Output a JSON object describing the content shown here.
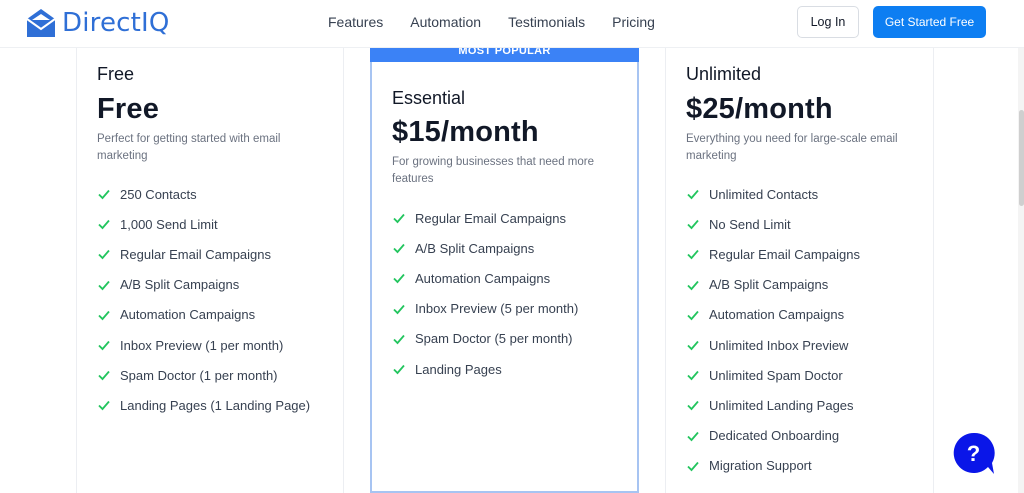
{
  "brand": {
    "name": "DirectIQ",
    "color": "#2f6fd6"
  },
  "nav": {
    "items": [
      "Features",
      "Automation",
      "Testimonials",
      "Pricing"
    ]
  },
  "header": {
    "login_label": "Log In",
    "cta_label": "Get Started Free"
  },
  "plans": [
    {
      "name": "Free",
      "price": "Free",
      "description": "Perfect for getting started with email marketing",
      "features": [
        "250 Contacts",
        "1,000 Send Limit",
        "Regular Email Campaigns",
        "A/B Split Campaigns",
        "Automation Campaigns",
        "Inbox Preview (1 per month)",
        "Spam Doctor (1 per month)",
        "Landing Pages (1 Landing Page)"
      ]
    },
    {
      "badge": "MOST POPULAR",
      "name": "Essential",
      "price": "$15/month",
      "description": "For growing businesses that need more features",
      "features": [
        "Regular Email Campaigns",
        "A/B Split Campaigns",
        "Automation Campaigns",
        "Inbox Preview (5 per month)",
        "Spam Doctor (5 per month)",
        "Landing Pages"
      ]
    },
    {
      "name": "Unlimited",
      "price": "$25/month",
      "description": "Everything you need for large-scale email marketing",
      "features": [
        "Unlimited Contacts",
        "No Send Limit",
        "Regular Email Campaigns",
        "A/B Split Campaigns",
        "Automation Campaigns",
        "Unlimited Inbox Preview",
        "Unlimited Spam Doctor",
        "Unlimited Landing Pages",
        "Dedicated Onboarding",
        "Migration Support"
      ]
    }
  ],
  "help": {
    "label": "?"
  },
  "colors": {
    "accent": "#0d7ef2",
    "check": "#22c55e",
    "popular_border": "#a7c4f2",
    "ribbon": "#3b82f6"
  },
  "icons": {
    "logo": "envelope-logo-icon",
    "check": "check-icon",
    "help": "help-chat-icon"
  }
}
